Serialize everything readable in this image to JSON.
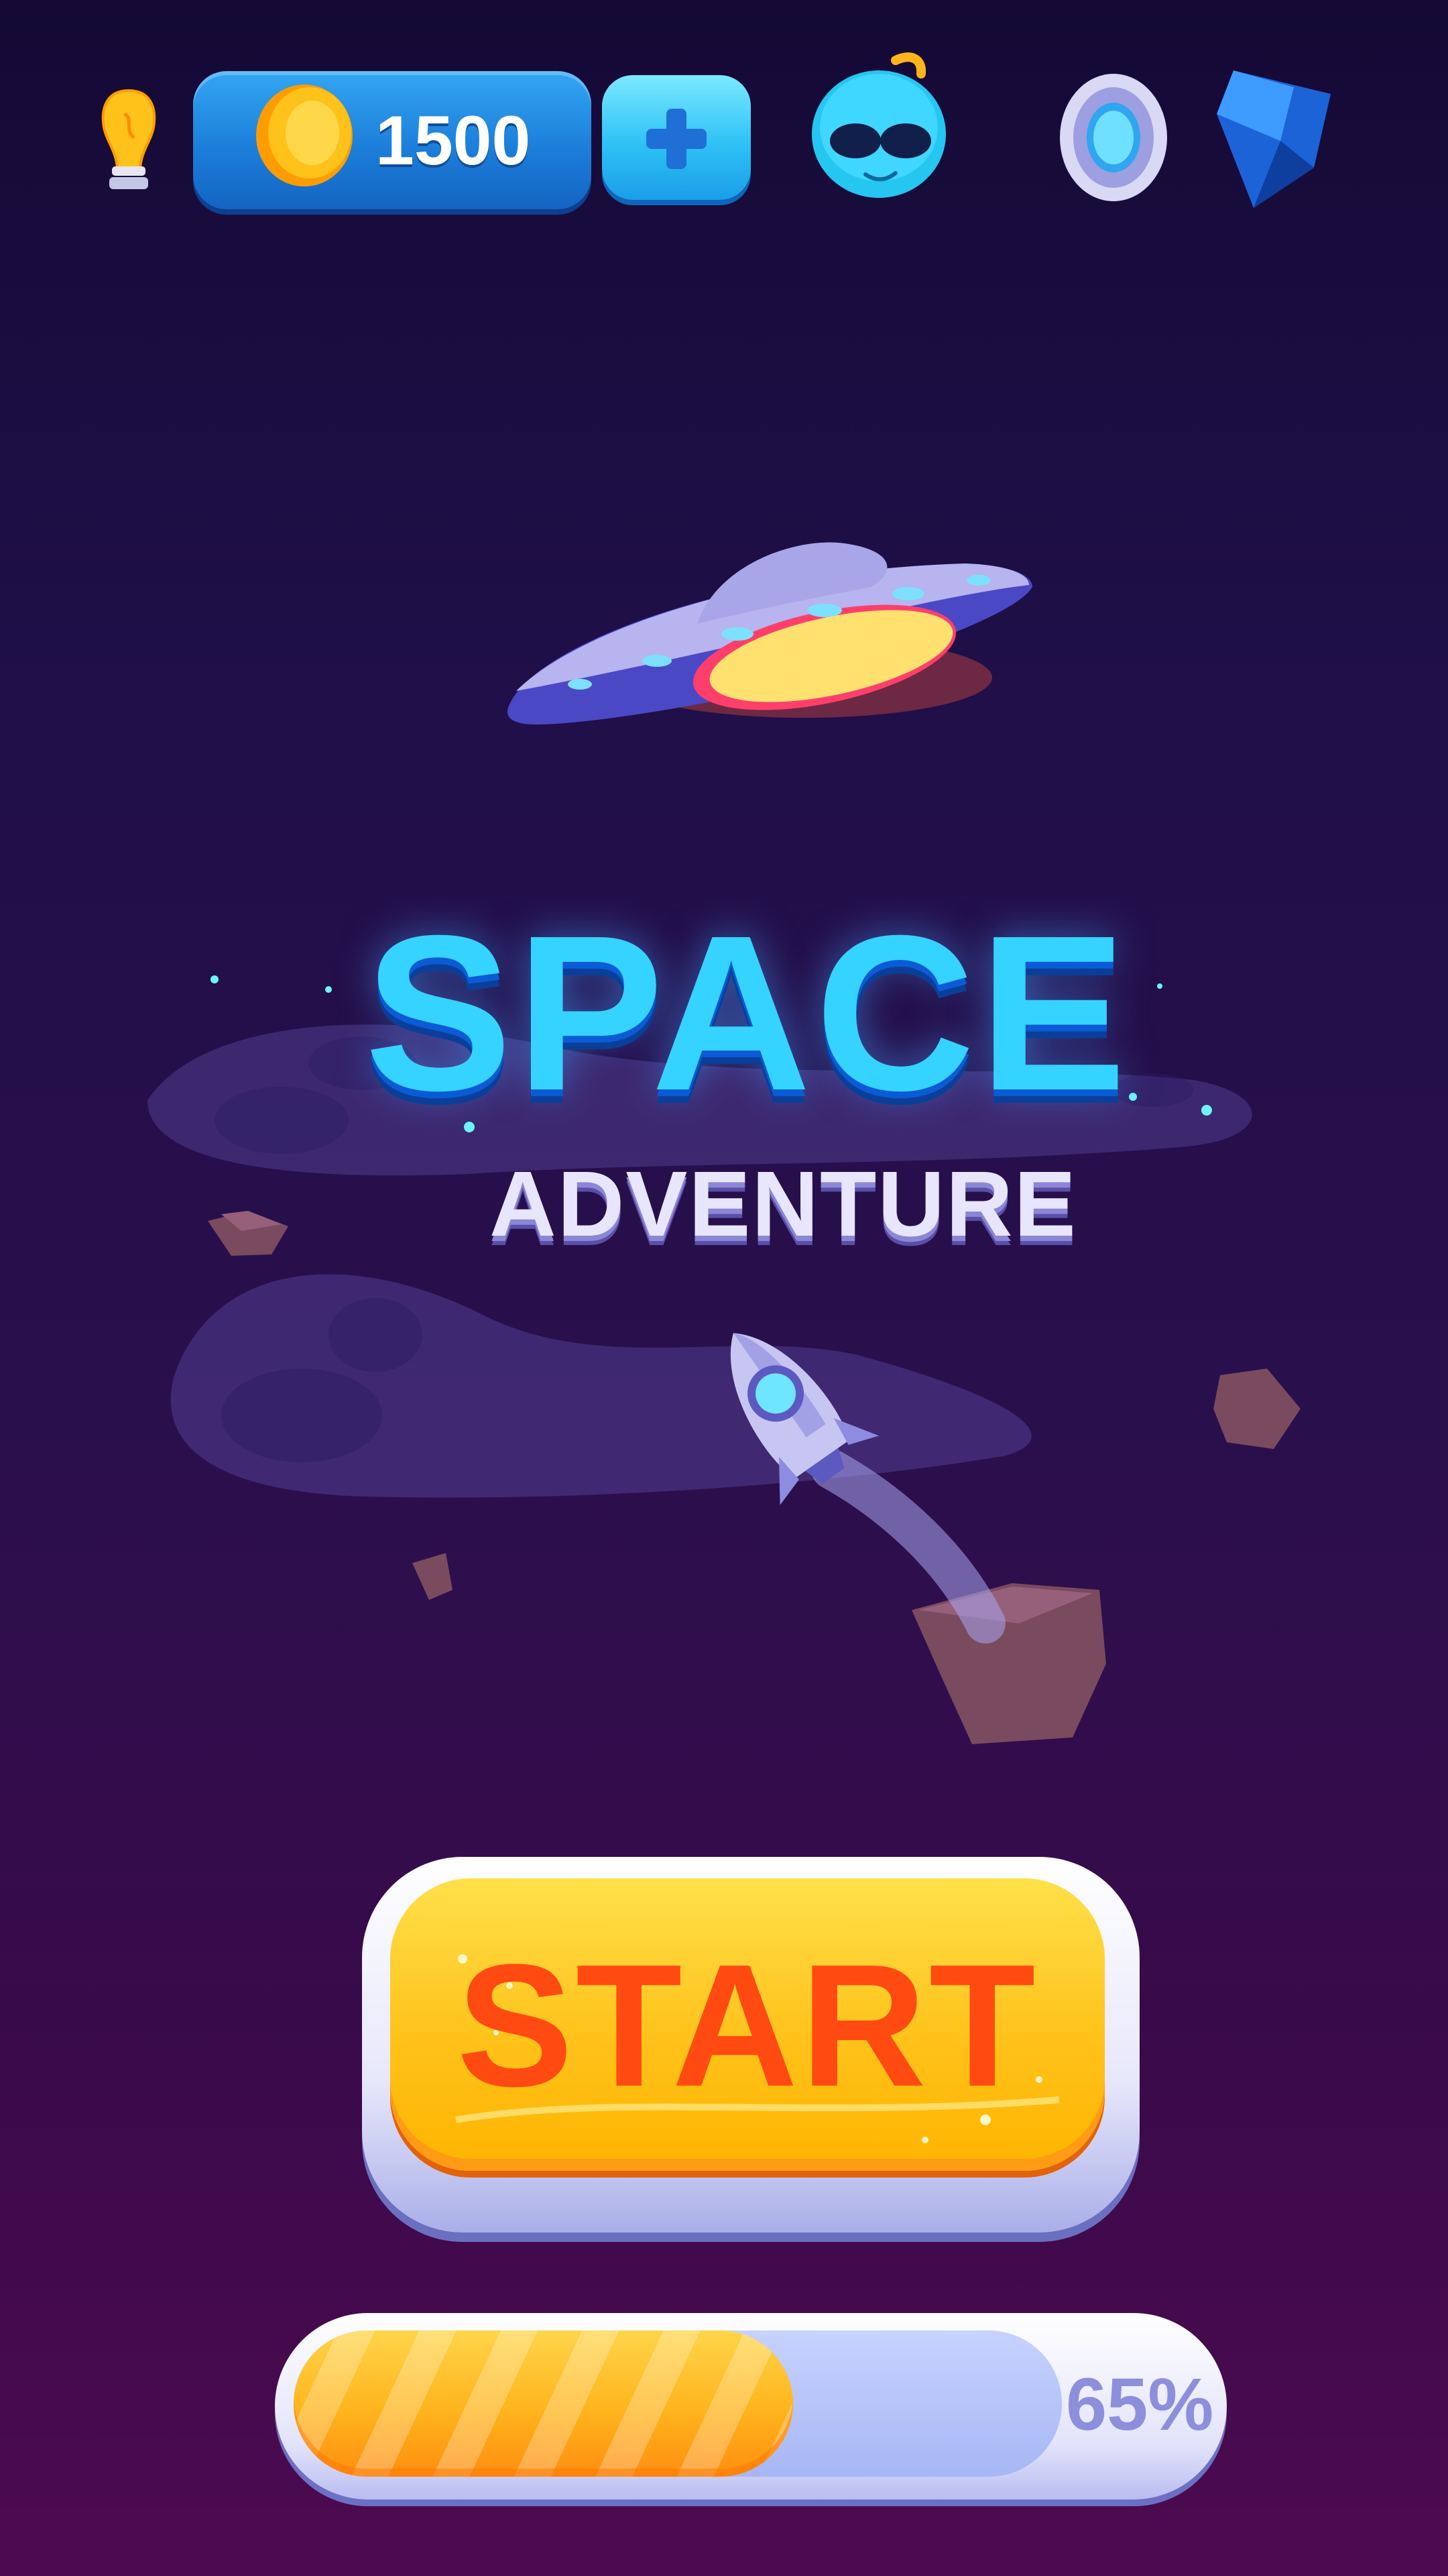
{
  "top_bar": {
    "coins": "1500",
    "add_icon": "plus-icon",
    "hint_icon": "lightbulb-icon",
    "avatar_icon": "alien-avatar-icon",
    "ring_icon": "ring-icon",
    "gem_icon": "gem-icon"
  },
  "title": {
    "main": "SPACE",
    "subtitle": "ADVENTURE"
  },
  "start_button": {
    "label": "START"
  },
  "progress": {
    "percent": 65,
    "label": "65%"
  },
  "colors": {
    "accent_blue": "#35d3ff",
    "start_yellow": "#ffc21a",
    "start_text": "#ff4a12",
    "progress_fill": "#ffb41c"
  }
}
